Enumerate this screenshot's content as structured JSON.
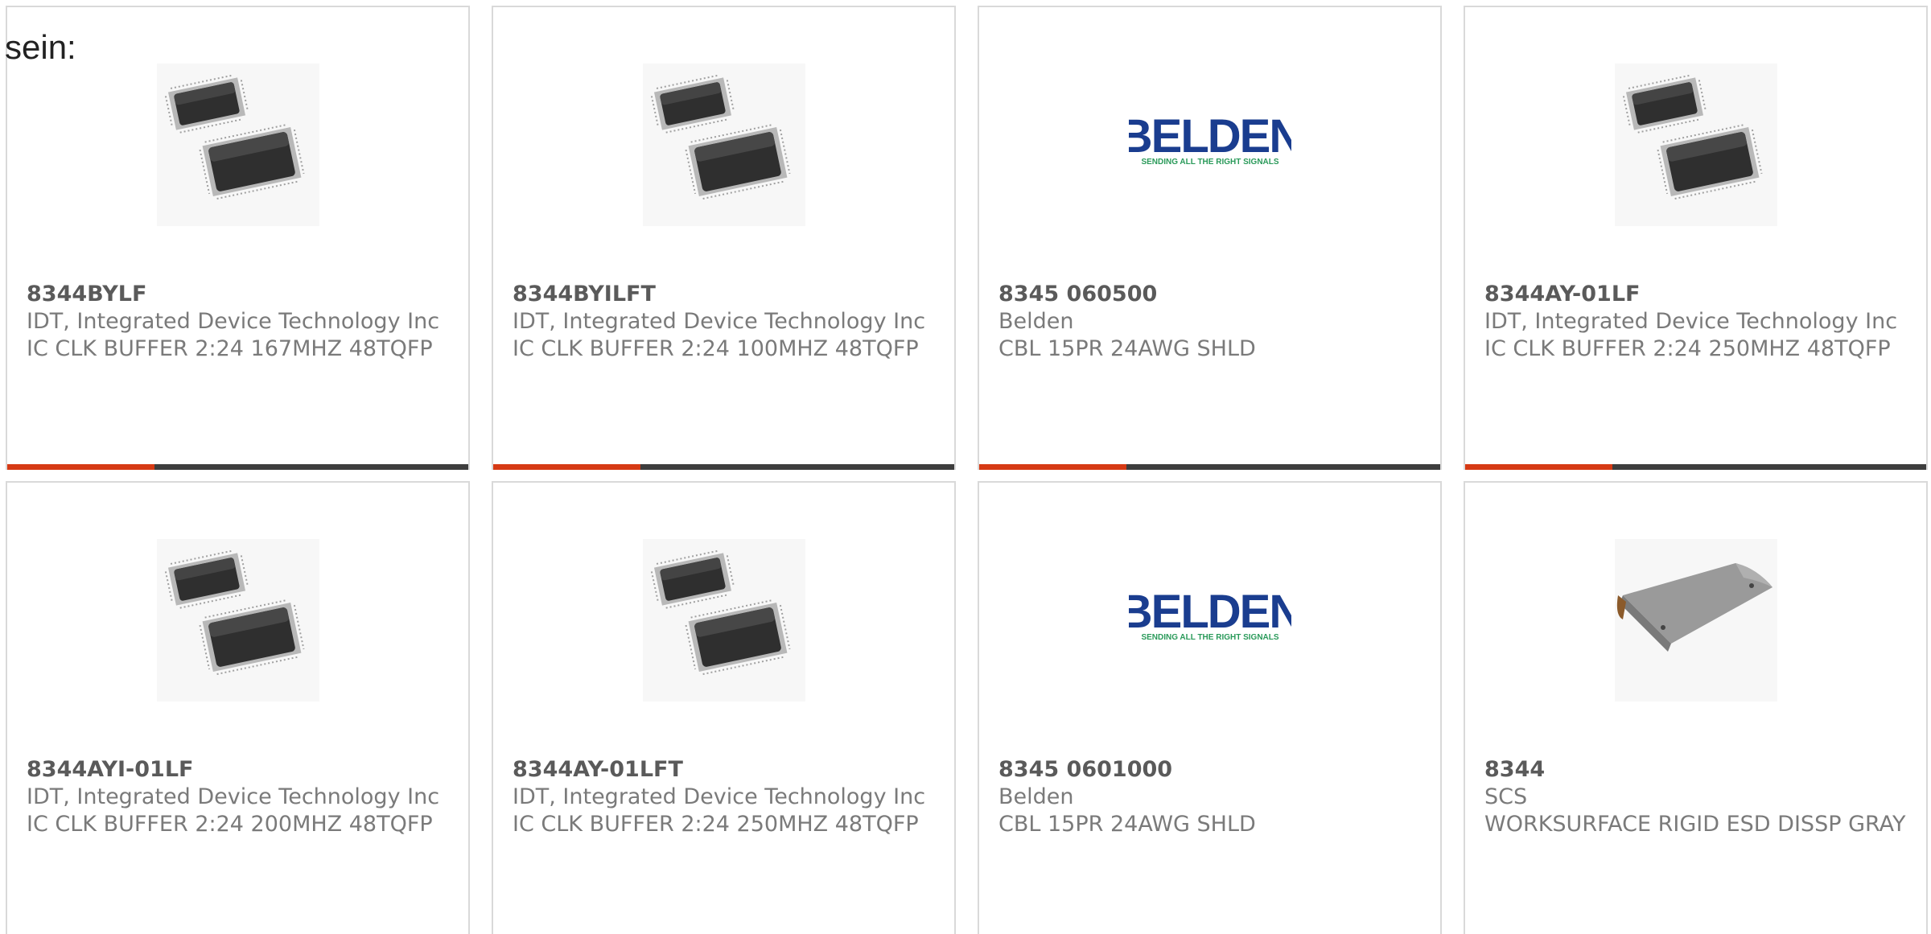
{
  "intro_text": "sein:",
  "colors": {
    "accent": "#d63a14",
    "bar": "#3d3d3d",
    "border": "#d9d9d9",
    "text": "#7a7a7a",
    "belden_blue": "#1a3d8f",
    "belden_green": "#2a9a5a"
  },
  "belden_logo": {
    "word": "BELDEN",
    "tagline": "SENDING ALL THE RIGHT SIGNALS"
  },
  "products": [
    {
      "part": "8344BYLF",
      "manufacturer": "IDT, Integrated Device Technology Inc",
      "description": "IC CLK BUFFER 2:24 167MHZ 48TQFP",
      "image": "tqfp-chip-icon"
    },
    {
      "part": "8344BYILFT",
      "manufacturer": "IDT, Integrated Device Technology Inc",
      "description": "IC CLK BUFFER 2:24 100MHZ 48TQFP",
      "image": "tqfp-chip-icon"
    },
    {
      "part": "8345 060500",
      "manufacturer": "Belden",
      "description": "CBL 15PR 24AWG SHLD",
      "image": "belden-logo"
    },
    {
      "part": "8344AY-01LF",
      "manufacturer": "IDT, Integrated Device Technology Inc",
      "description": "IC CLK BUFFER 2:24 250MHZ 48TQFP",
      "image": "tqfp-chip-icon"
    },
    {
      "part": "8344AYI-01LF",
      "manufacturer": "IDT, Integrated Device Technology Inc",
      "description": "IC CLK BUFFER 2:24 200MHZ 48TQFP",
      "image": "tqfp-chip-icon"
    },
    {
      "part": "8344AY-01LFT",
      "manufacturer": "IDT, Integrated Device Technology Inc",
      "description": "IC CLK BUFFER 2:24 250MHZ 48TQFP",
      "image": "tqfp-chip-icon"
    },
    {
      "part": "8345 0601000",
      "manufacturer": "Belden",
      "description": "CBL 15PR 24AWG SHLD",
      "image": "belden-logo"
    },
    {
      "part": "8344",
      "manufacturer": "SCS",
      "description": "WORKSURFACE RIGID ESD DISSP GRAY",
      "image": "esd-mat-icon"
    }
  ]
}
